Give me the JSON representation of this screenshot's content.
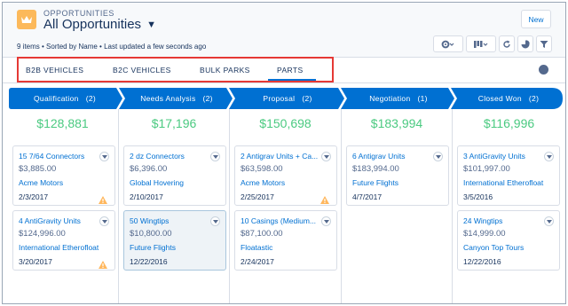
{
  "header": {
    "object_label": "OPPORTUNITIES",
    "title": "All Opportunities",
    "subtitle": "9 items • Sorted by Name • Last updated a few seconds ago",
    "new_button": "New",
    "icons": [
      "gear-icon",
      "board-view-icon",
      "refresh-icon",
      "chart-icon",
      "filter-icon"
    ]
  },
  "tabs": [
    {
      "label": "B2B VEHICLES",
      "active": false
    },
    {
      "label": "B2C VEHICLES",
      "active": false
    },
    {
      "label": "BULK PARKS",
      "active": false
    },
    {
      "label": "PARTS",
      "active": true
    }
  ],
  "stages": [
    {
      "label": "Qualification",
      "count": "(2)",
      "total": "$128,881"
    },
    {
      "label": "Needs Analysis",
      "count": "(2)",
      "total": "$17,196"
    },
    {
      "label": "Proposal",
      "count": "(2)",
      "total": "$150,698"
    },
    {
      "label": "Negotiation",
      "count": "(1)",
      "total": "$183,994"
    },
    {
      "label": "Closed Won",
      "count": "(2)",
      "total": "$116,996"
    }
  ],
  "cards": [
    [
      {
        "name": "15 7/64 Connectors",
        "amount": "$3,885.00",
        "account": "Acme Motors",
        "date": "2/3/2017",
        "warning": true
      },
      {
        "name": "4 AntiGravity Units",
        "amount": "$124,996.00",
        "account": "International Etherofloat",
        "date": "3/20/2017",
        "warning": true
      }
    ],
    [
      {
        "name": "2 dz Connectors",
        "amount": "$6,396.00",
        "account": "Global Hovering",
        "date": "2/10/2017",
        "warning": false
      },
      {
        "name": "50 Wingtips",
        "amount": "$10,800.00",
        "account": "Future Flights",
        "date": "12/22/2016",
        "warning": false,
        "selected": true
      }
    ],
    [
      {
        "name": "2 Antigrav Units + Ca...",
        "amount": "$63,598.00",
        "account": "Acme Motors",
        "date": "2/25/2017",
        "warning": true
      },
      {
        "name": "10 Casings (Medium...",
        "amount": "$87,100.00",
        "account": "Floatastic",
        "date": "2/24/2017",
        "warning": false
      }
    ],
    [
      {
        "name": "6 Antigrav Units",
        "amount": "$183,994.00",
        "account": "Future Flights",
        "date": "4/7/2017",
        "warning": false
      }
    ],
    [
      {
        "name": "3 AntiGravity Units",
        "amount": "$101,997.00",
        "account": "International Etherofloat",
        "date": "3/5/2016",
        "warning": false
      },
      {
        "name": "24 Wingtips",
        "amount": "$14,999.00",
        "account": "Canyon Top Tours",
        "date": "12/22/2016",
        "warning": false
      }
    ]
  ],
  "colors": {
    "stage_blue": "#0070d2",
    "total_green": "#4bca81",
    "link_blue": "#0070d2",
    "warning_orange": "#ffb75d",
    "highlight_red": "#e53935"
  }
}
